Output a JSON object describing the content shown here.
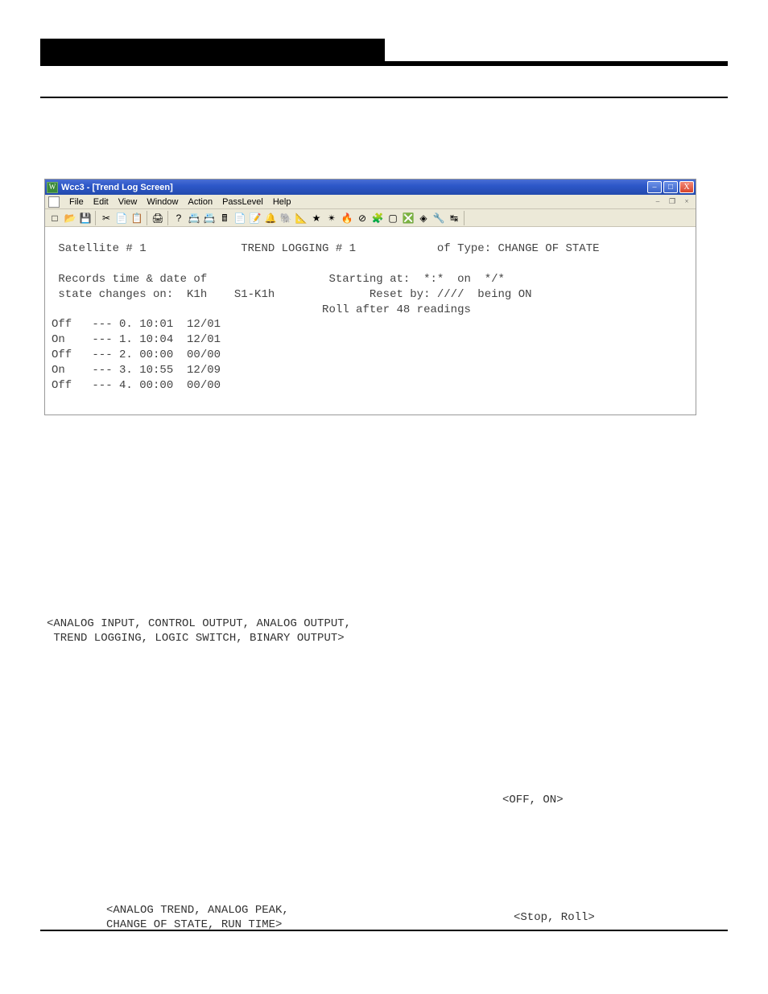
{
  "window": {
    "app_icon_letter": "W",
    "title": "Wcc3 - [Trend Log Screen]",
    "buttons": {
      "min": "–",
      "max": "□",
      "close": "X"
    },
    "menu": {
      "items": [
        "File",
        "Edit",
        "View",
        "Window",
        "Action",
        "PassLevel",
        "Help"
      ],
      "right": {
        "min": "–",
        "restore": "❐",
        "close": "×"
      }
    },
    "toolbar_icons": [
      "□",
      "📂",
      "💾",
      "|",
      "✂",
      "📄",
      "📋",
      "|",
      "🖨",
      "|",
      "?",
      "📇",
      "📇",
      "🖩",
      "📄",
      "📝",
      "🔔",
      "🐘",
      "📐",
      "★",
      "✴",
      "🔥",
      "⊘",
      "🧩",
      "▢",
      "❎",
      "◈",
      "🔧",
      "↹"
    ],
    "content": " Satellite # 1              TREND LOGGING # 1            of Type: CHANGE OF STATE\n\n Records time & date of                  Starting at:  *:*  on  */*\n state changes on:  K1h    S1-K1h              Reset by: ////  being ON\n                                        Roll after 48 readings\nOff   --- 0. 10:01  12/01\nOn    --- 1. 10:04  12/01\nOff   --- 2. 00:00  00/00\nOn    --- 3. 10:55  12/09\nOff   --- 4. 00:00  00/00"
  },
  "body_blocks": {
    "types_list": "<ANALOG INPUT, CONTROL OUTPUT, ANALOG OUTPUT,\n TREND LOGGING, LOGIC SWITCH, BINARY OUTPUT>",
    "off_on": "<OFF, ON>",
    "trend_types": "<ANALOG TREND, ANALOG PEAK,\nCHANGE OF STATE, RUN TIME>",
    "stop_roll": "<Stop, Roll>"
  }
}
